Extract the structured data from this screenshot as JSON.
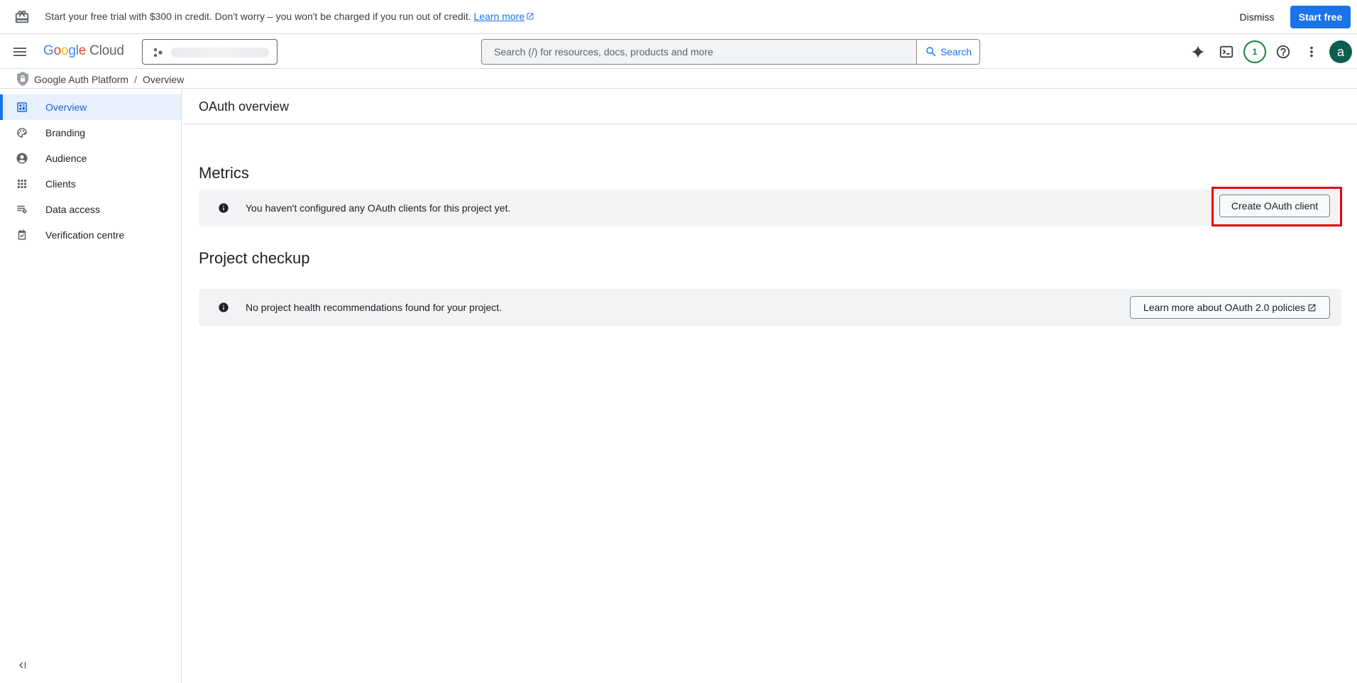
{
  "banner": {
    "message": "Start your free trial with $300 in credit. Don't worry – you won't be charged if you run out of credit.",
    "learn_more": "Learn more",
    "dismiss": "Dismiss",
    "start_free": "Start free"
  },
  "appbar": {
    "logo_letters": [
      "G",
      "o",
      "o",
      "g",
      "l",
      "e"
    ],
    "logo_product": "Cloud",
    "search_placeholder": "Search (/) for resources, docs, products and more",
    "search_button": "Search",
    "notification_count": "1",
    "avatar_initial": "a"
  },
  "breadcrumb": {
    "product": "Google Auth Platform",
    "page": "Overview",
    "separator": "/"
  },
  "sidebar": {
    "items": [
      {
        "label": "Overview",
        "icon": "dashboard-icon",
        "active": true
      },
      {
        "label": "Branding",
        "icon": "palette-icon",
        "active": false
      },
      {
        "label": "Audience",
        "icon": "account-circle-icon",
        "active": false
      },
      {
        "label": "Clients",
        "icon": "apps-grid-icon",
        "active": false
      },
      {
        "label": "Data access",
        "icon": "data-access-icon",
        "active": false
      },
      {
        "label": "Verification centre",
        "icon": "verification-icon",
        "active": false
      }
    ]
  },
  "main": {
    "title": "OAuth overview",
    "metrics": {
      "heading": "Metrics",
      "notice": "You haven't configured any OAuth clients for this project yet.",
      "button": "Create OAuth client"
    },
    "checkup": {
      "heading": "Project checkup",
      "notice": "No project health recommendations found for your project.",
      "button": "Learn more about OAuth 2.0 policies"
    }
  },
  "colors": {
    "accent": "#1a73e8",
    "highlight": "#e3000f",
    "notice_bg": "#f1f3f4",
    "avatar_bg": "#0d5e4e",
    "notification": "#188038"
  }
}
